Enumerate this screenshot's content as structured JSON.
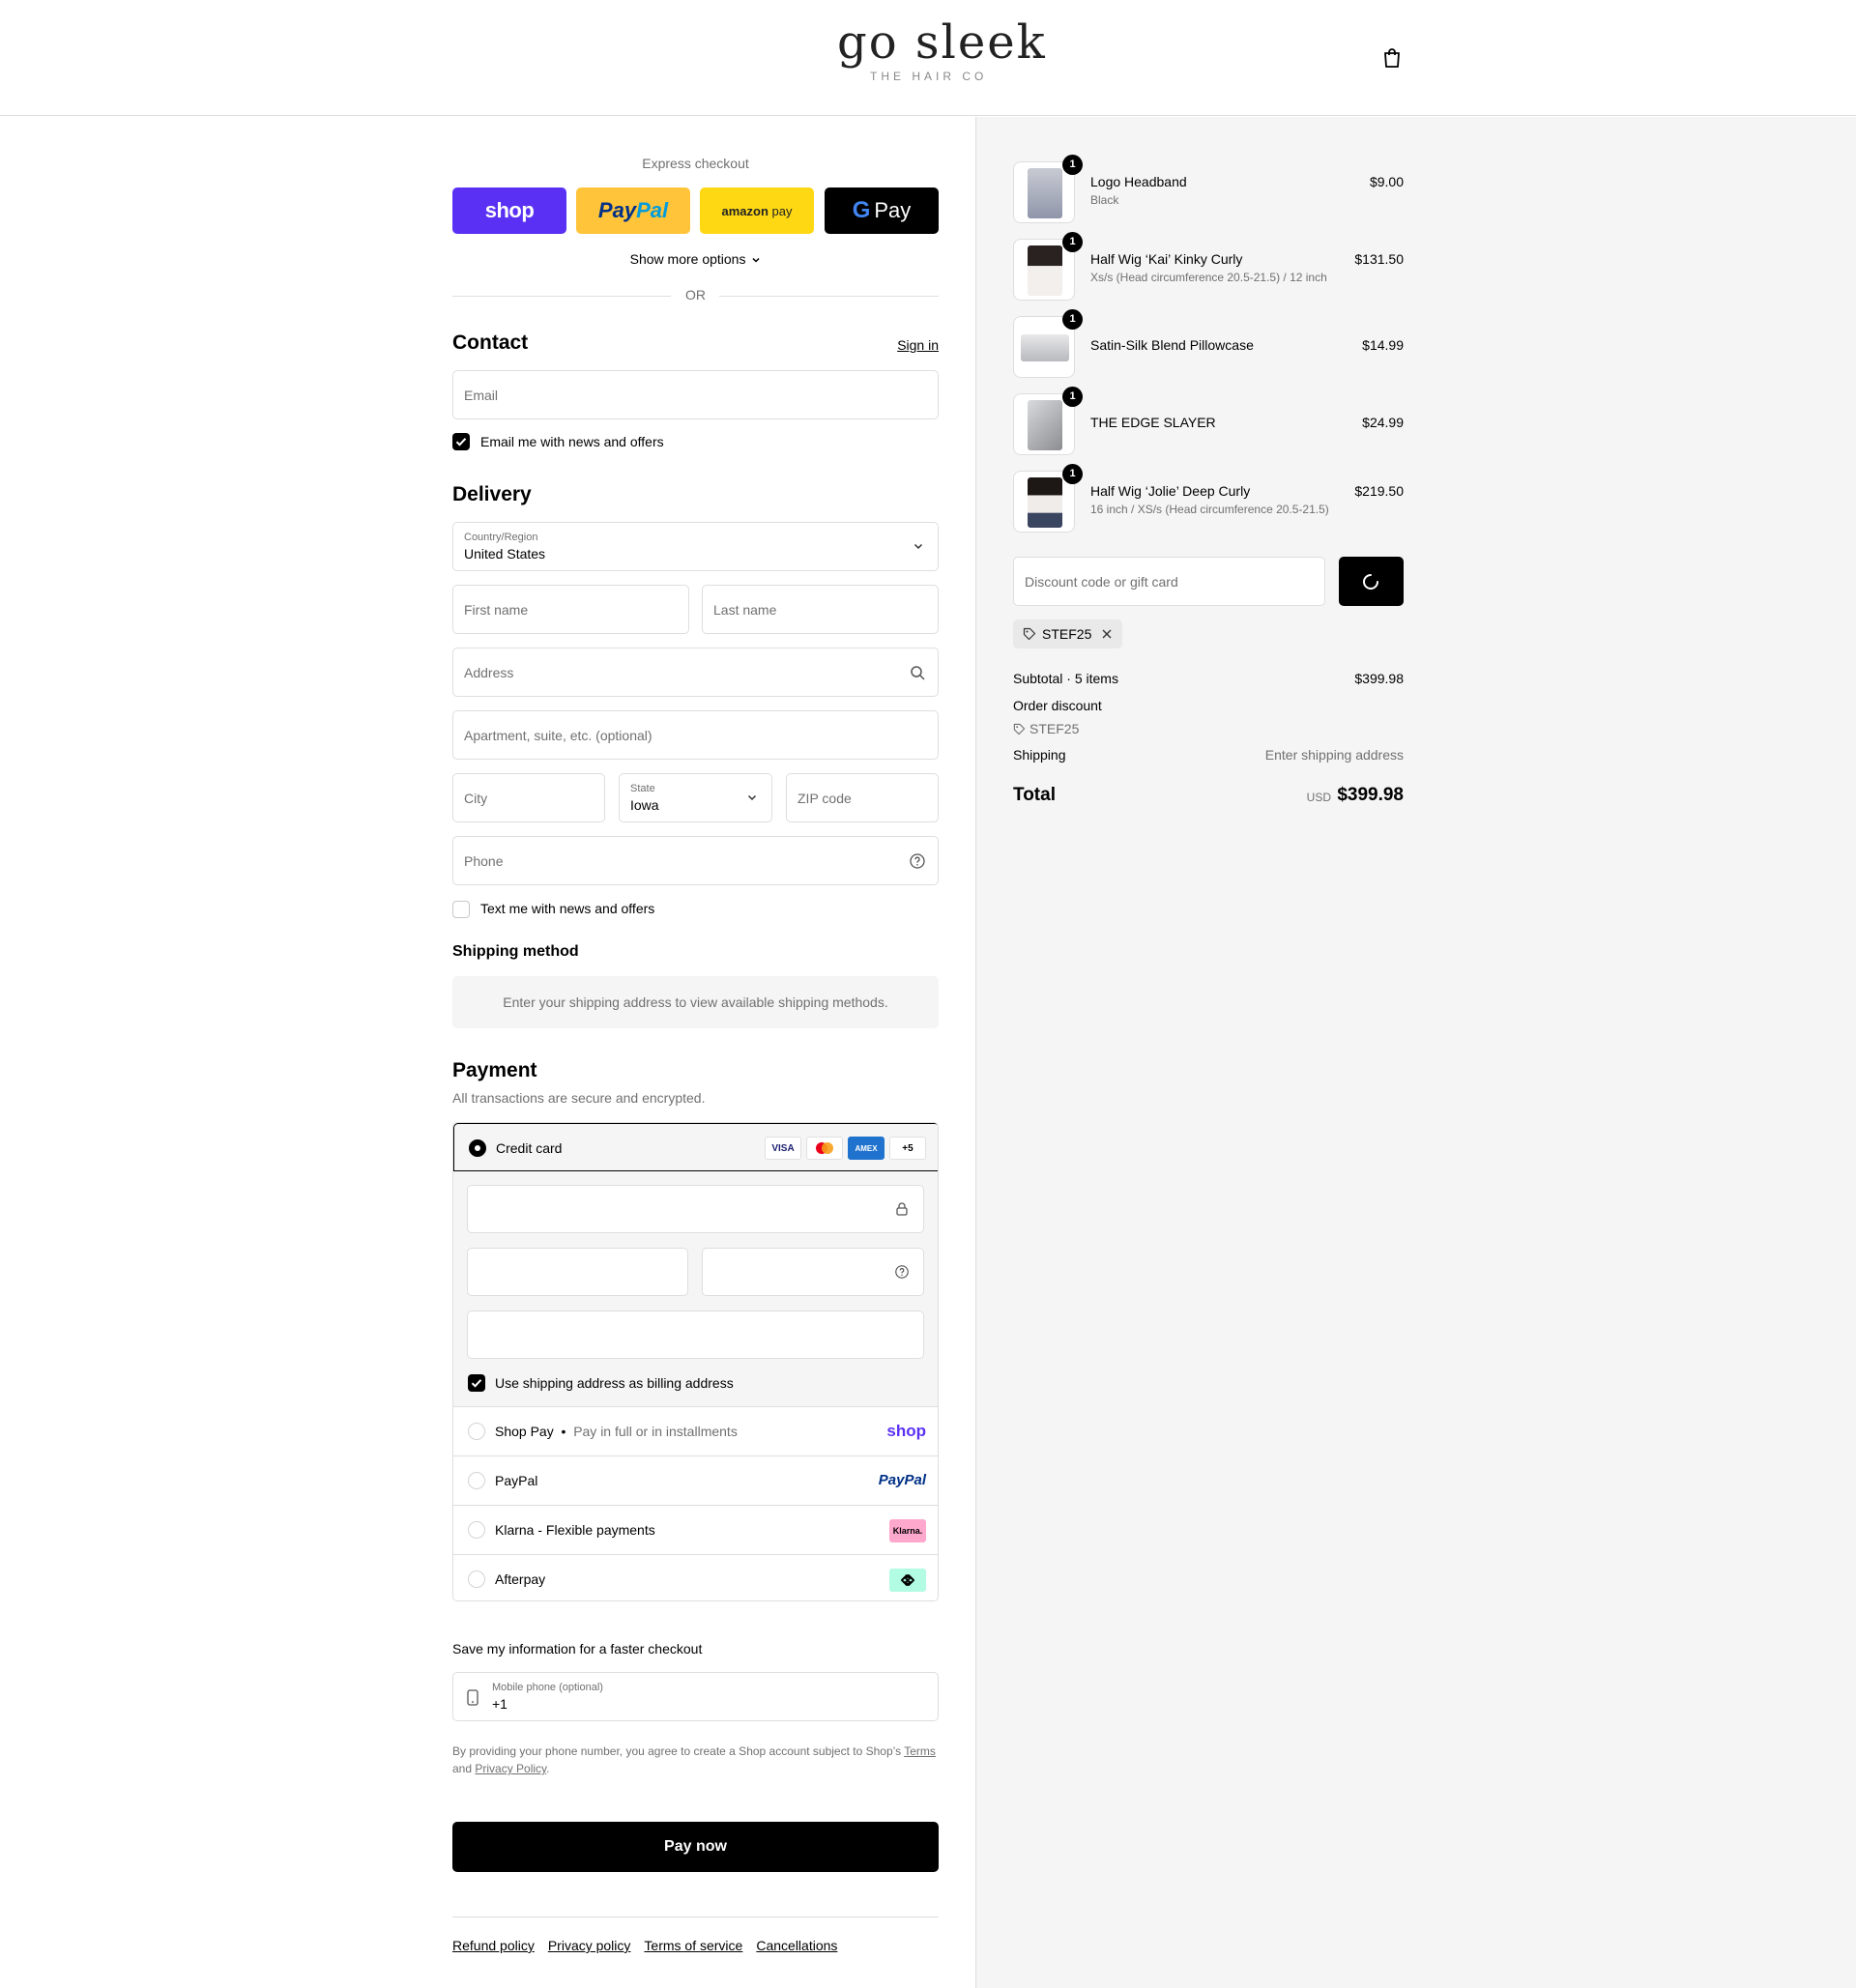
{
  "header": {
    "logo_main": "go sleek",
    "logo_sub": "THE HAIR CO"
  },
  "express": {
    "title": "Express checkout",
    "shop_label": "shop",
    "paypal_pay": "Pay",
    "paypal_pal": "Pal",
    "amazon_brand": "amazon",
    "amazon_pay": "pay",
    "gpay_g": "G",
    "gpay_label": "Pay",
    "more_options": "Show more options",
    "or": "OR"
  },
  "contact": {
    "title": "Contact",
    "signin": "Sign in",
    "email_placeholder": "Email",
    "email_news_label": "Email me with news and offers"
  },
  "delivery": {
    "title": "Delivery",
    "country_label": "Country/Region",
    "country_value": "United States",
    "first_name": "First name",
    "last_name": "Last name",
    "address": "Address",
    "apartment": "Apartment, suite, etc. (optional)",
    "city": "City",
    "state_label": "State",
    "state_value": "Iowa",
    "zip": "ZIP code",
    "phone": "Phone",
    "text_news_label": "Text me with news and offers"
  },
  "shipping_method": {
    "title": "Shipping method",
    "message": "Enter your shipping address to view available shipping methods."
  },
  "payment": {
    "title": "Payment",
    "note": "All transactions are secure and encrypted.",
    "credit_card_label": "Credit card",
    "card_badges": [
      "VISA",
      "",
      "AMEX",
      "+5"
    ],
    "billing_label": "Use shipping address as billing address",
    "options": [
      {
        "label": "Shop Pay",
        "sub": "Pay in full or in installments",
        "logo": "shop"
      },
      {
        "label": "PayPal",
        "sub": "",
        "logo": "PayPal"
      },
      {
        "label": "Klarna - Flexible payments",
        "sub": "",
        "logo": "Klarna."
      },
      {
        "label": "Afterpay",
        "sub": "",
        "logo": ""
      }
    ]
  },
  "save_info": {
    "title": "Save my information for a faster checkout",
    "mobile_label": "Mobile phone (optional)",
    "mobile_value": "+1",
    "terms_prefix": "By providing your phone number, you agree to create a Shop account subject to Shop’s",
    "terms_link": "Terms",
    "terms_and": "and",
    "privacy_link": "Privacy Policy",
    "terms_end": "."
  },
  "pay_now": "Pay now",
  "footer_links": [
    "Refund policy",
    "Privacy policy",
    "Terms of service",
    "Cancellations"
  ],
  "summary": {
    "items": [
      {
        "name": "Logo Headband",
        "variant": "Black",
        "price": "$9.00",
        "qty": "1"
      },
      {
        "name": "Half Wig ‘Kai’ Kinky Curly",
        "variant": "Xs/s (Head circumference 20.5-21.5) / 12 inch",
        "price": "$131.50",
        "qty": "1"
      },
      {
        "name": "Satin-Silk Blend Pillowcase",
        "variant": "",
        "price": "$14.99",
        "qty": "1"
      },
      {
        "name": "THE EDGE SLAYER",
        "variant": "",
        "price": "$24.99",
        "qty": "1"
      },
      {
        "name": "Half Wig ‘Jolie’ Deep Curly",
        "variant": "16 inch / XS/s (Head circumference 20.5-21.5)",
        "price": "$219.50",
        "qty": "1"
      }
    ],
    "discount_placeholder": "Discount code or gift card",
    "applied_code": "STEF25",
    "subtotal_label": "Subtotal · 5 items",
    "subtotal_value": "$399.98",
    "order_discount_label": "Order discount",
    "order_discount_code": "STEF25",
    "shipping_label": "Shipping",
    "shipping_value": "Enter shipping address",
    "total_label": "Total",
    "total_currency": "USD",
    "total_value": "$399.98"
  }
}
